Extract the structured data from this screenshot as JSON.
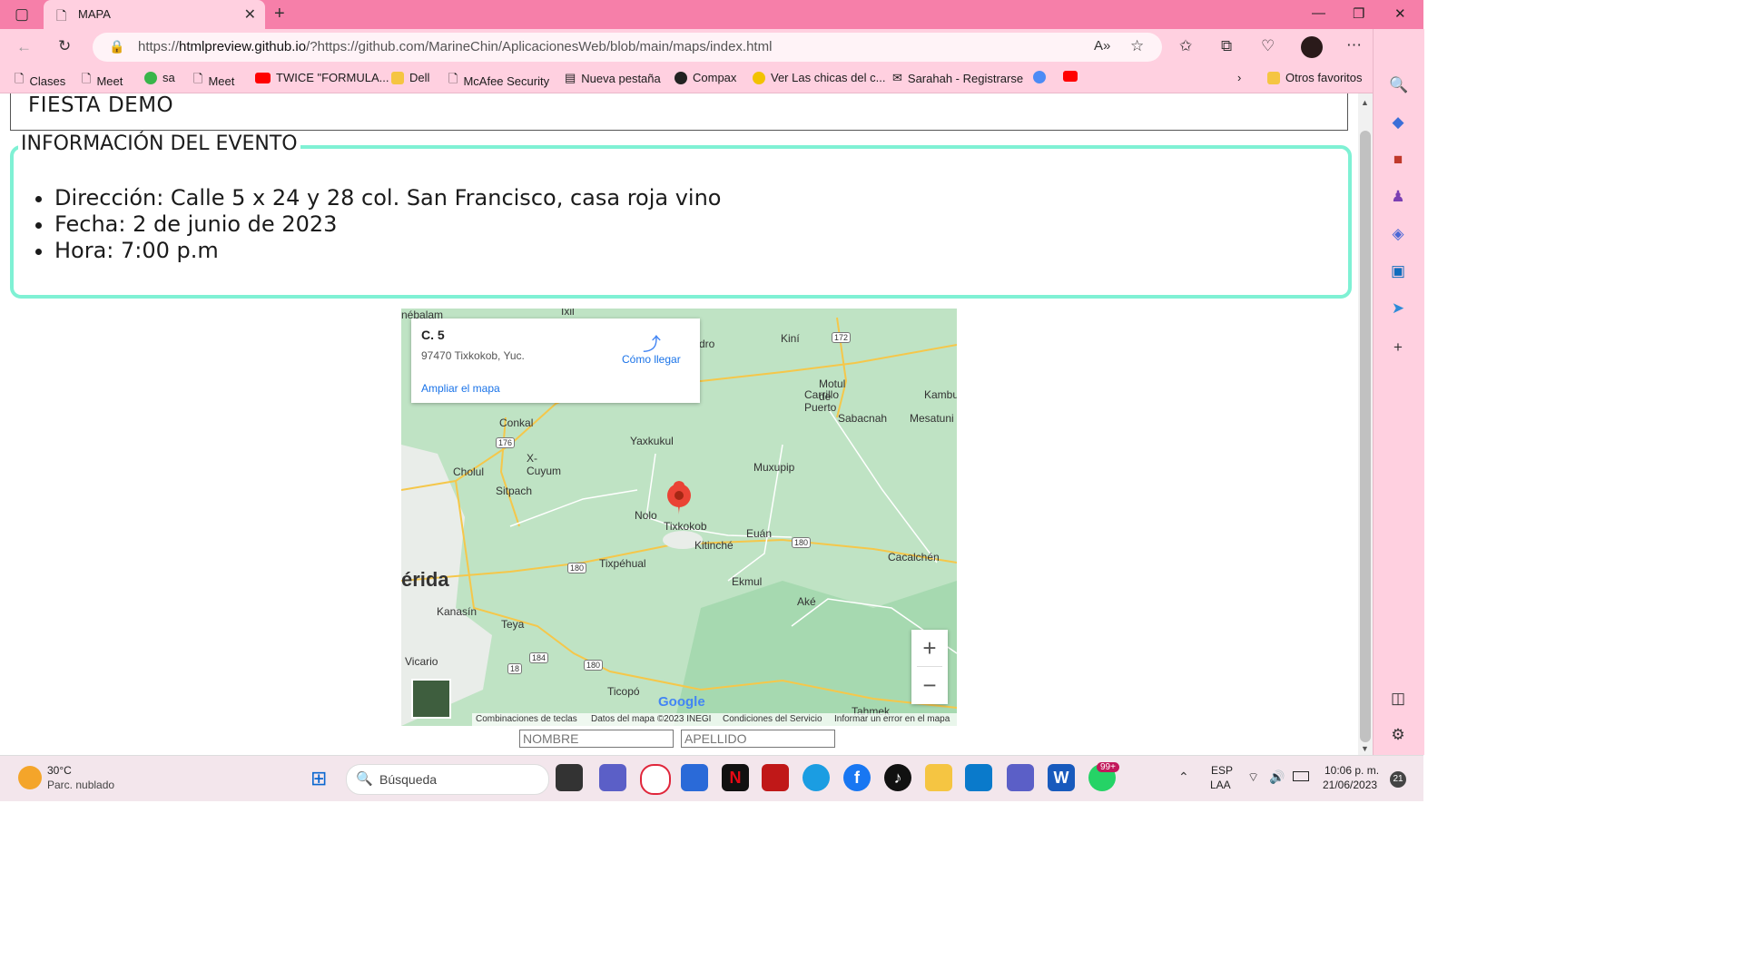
{
  "browser": {
    "tab_title": "MAPA",
    "url_prefix": "https://",
    "url_host": "htmlpreview.github.io",
    "url_rest": "/?https://github.com/MarineChin/AplicacionesWeb/blob/main/maps/index.html",
    "bookmarks": [
      "Clases",
      "Meet",
      "sa",
      "Meet",
      "TWICE \"FORMULA...",
      "Dell",
      "McAfee Security",
      "Nueva pestaña",
      "Compax",
      "Ver Las chicas del c...",
      "Sarahah - Registrarse"
    ],
    "other_favorites": "Otros favoritos"
  },
  "page": {
    "header_title": "FIESTA DEMO",
    "legend": "INFORMACIÓN DEL EVENTO",
    "info": [
      "Dirección: Calle 5 x 24 y 28 col. San Francisco, casa roja vino",
      "Fecha: 2 de junio de 2023",
      "Hora: 7:00 p.m"
    ],
    "form": {
      "nombre_placeholder": "NOMBRE",
      "apellido_placeholder": "APELLIDO"
    }
  },
  "map": {
    "card_title": "C. 5",
    "card_address": "97470 Tixkokob, Yuc.",
    "directions_label": "Cómo llegar",
    "enlarge_label": "Ampliar el mapa",
    "places": [
      "nébalam",
      "Ixil",
      "dro",
      "Kiní",
      "Motul de",
      "Carrillo Puerto",
      "Kambu",
      "Sabacnah",
      "Mesatuni",
      "Conkal",
      "Yaxkukul",
      "X-Cuyum",
      "Cholul",
      "Muxupip",
      "Sitpach",
      "Nolo",
      "Tixkokob",
      "Euán",
      "Kitinché",
      "Cacalchén",
      "Tixpéhual",
      "érida",
      "Ekmul",
      "Aké",
      "Kanasín",
      "Teya",
      "Vicario",
      "Ticopó",
      "Tahmek"
    ],
    "road_labels": [
      "172",
      "176",
      "180",
      "180",
      "184",
      "18",
      "180"
    ],
    "footer": [
      "Combinaciones de teclas",
      "Datos del mapa ©2023 INEGI",
      "Condiciones del Servicio",
      "Informar un error en el mapa"
    ],
    "zoom_in": "+",
    "zoom_out": "−",
    "google": "Google"
  },
  "taskbar": {
    "weather_temp": "30°C",
    "weather_desc": "Parc. nublado",
    "search_label": "Búsqueda",
    "lang1": "ESP",
    "lang2": "LAA",
    "time": "10:06 p. m.",
    "date": "21/06/2023",
    "notif_count": "21",
    "whatsapp_badge": "99+"
  },
  "colors": {
    "titlebar": "#f67fa9",
    "toolbar": "#ffd0e0",
    "fieldset_border": "#7ff1d4",
    "map_green": "#b9dfbf"
  }
}
